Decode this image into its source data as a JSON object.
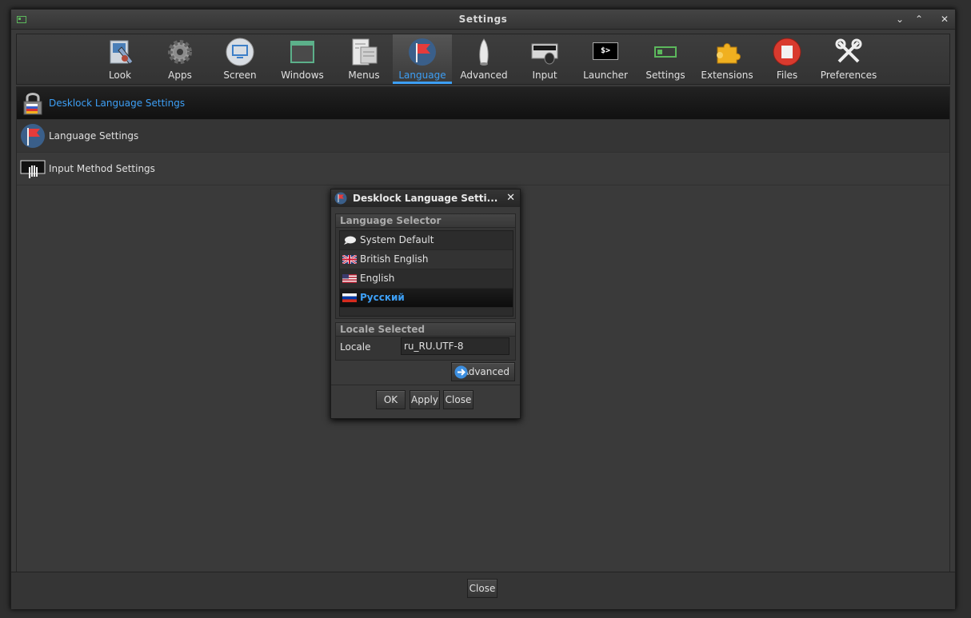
{
  "window": {
    "title": "Settings"
  },
  "toolbar": {
    "items": [
      {
        "label": "Look",
        "icon": "look-icon"
      },
      {
        "label": "Apps",
        "icon": "apps-gear-icon"
      },
      {
        "label": "Screen",
        "icon": "screen-icon"
      },
      {
        "label": "Windows",
        "icon": "windows-icon"
      },
      {
        "label": "Menus",
        "icon": "menus-icon"
      },
      {
        "label": "Language",
        "icon": "language-flag-icon",
        "active": true
      },
      {
        "label": "Advanced",
        "icon": "advanced-rocket-icon"
      },
      {
        "label": "Input",
        "icon": "input-mouse-icon"
      },
      {
        "label": "Launcher",
        "icon": "launcher-terminal-icon"
      },
      {
        "label": "Settings",
        "icon": "settings-battery-icon"
      },
      {
        "label": "Extensions",
        "icon": "extensions-puzzle-icon"
      },
      {
        "label": "Files",
        "icon": "files-icon"
      },
      {
        "label": "Preferences",
        "icon": "preferences-tools-icon"
      }
    ],
    "terminal_glyph": "$>"
  },
  "list": {
    "items": [
      {
        "label": "Desklock Language Settings",
        "selected": true
      },
      {
        "label": "Language Settings"
      },
      {
        "label": "Input Method Settings"
      }
    ]
  },
  "dialog": {
    "title": "Desklock Language Setti...",
    "language_selector": {
      "header": "Language Selector",
      "items": [
        {
          "label": "System Default",
          "icon": "speech-bubble-icon"
        },
        {
          "label": "British English",
          "icon": "uk-flag-icon"
        },
        {
          "label": "English",
          "icon": "us-flag-icon"
        },
        {
          "label": "Русский",
          "icon": "russia-flag-icon",
          "selected": true
        }
      ]
    },
    "locale_selected": {
      "header": "Locale Selected",
      "label": "Locale",
      "value": "ru_RU.UTF-8"
    },
    "advanced_label": "Advanced",
    "ok_label": "OK",
    "apply_label": "Apply",
    "close_label": "Close"
  },
  "bottom": {
    "close_label": "Close"
  },
  "colors": {
    "accent": "#3d9ff5",
    "background": "#3a3a3a"
  }
}
